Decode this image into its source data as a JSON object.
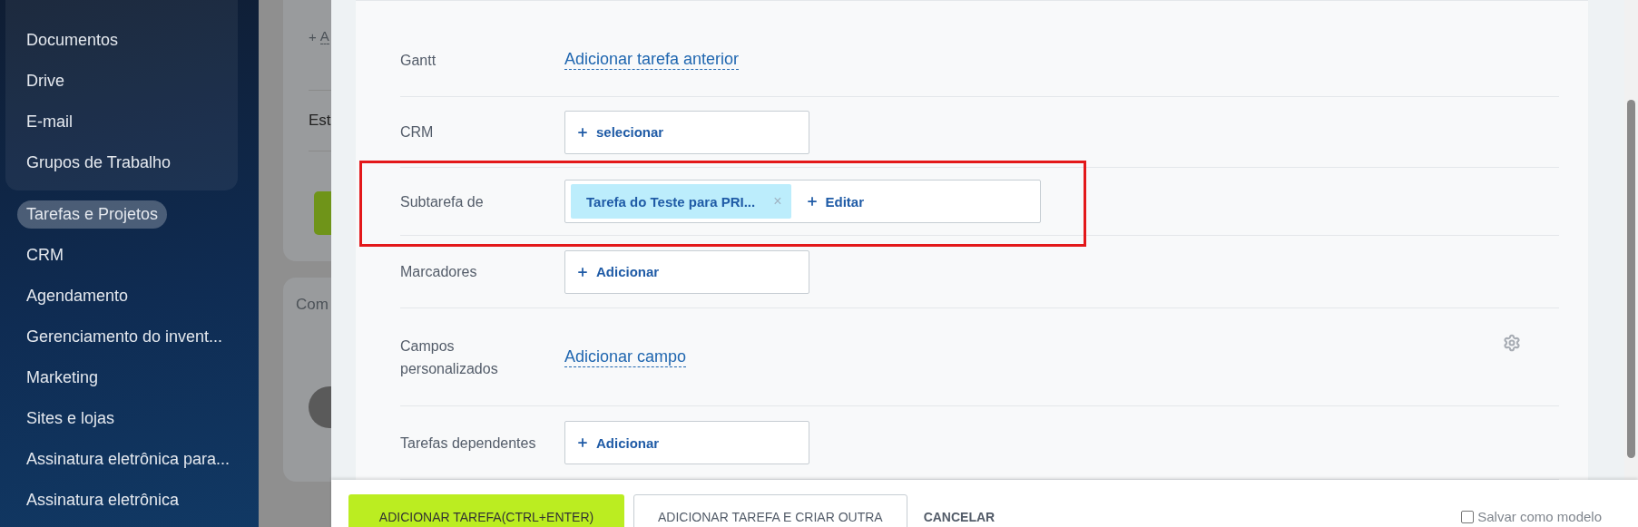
{
  "sidebar": {
    "group_items": [
      {
        "label": "Documentos",
        "selected": false
      },
      {
        "label": "Drive",
        "selected": false
      },
      {
        "label": "E-mail",
        "selected": false
      },
      {
        "label": "Grupos de Trabalho",
        "selected": false
      }
    ],
    "items": [
      {
        "label": "Tarefas e Projetos",
        "selected": true
      },
      {
        "label": "CRM",
        "selected": false
      },
      {
        "label": "Agendamento",
        "selected": false
      },
      {
        "label": "Gerenciamento do invent...",
        "selected": false
      },
      {
        "label": "Marketing",
        "selected": false
      },
      {
        "label": "Sites e lojas",
        "selected": false
      },
      {
        "label": "Assinatura eletrônica para...",
        "selected": false
      },
      {
        "label": "Assinatura eletrônica",
        "selected": false
      }
    ]
  },
  "background_page": {
    "card_link_plus": "+",
    "card_link": "A",
    "card_row": "Est",
    "comments_title": "Com"
  },
  "form": {
    "rows": [
      {
        "label": "Gantt",
        "kind": "link",
        "link": "Adicionar tarefa anterior",
        "highlighted": false,
        "gear": false
      },
      {
        "label": "CRM",
        "kind": "picker",
        "action": "selecionar",
        "highlighted": false
      },
      {
        "label": "Subtarefa de",
        "kind": "tags",
        "tags": [
          {
            "label": "Tarefa do Teste para PRI...",
            "remove": "×"
          }
        ],
        "action": "Editar",
        "highlighted": true
      },
      {
        "label": "Marcadores",
        "kind": "picker",
        "action": "Adicionar",
        "highlighted": false
      },
      {
        "label": "Campos personalizados",
        "kind": "link",
        "link": "Adicionar campo",
        "highlighted": false,
        "gear": true
      },
      {
        "label": "Tarefas dependentes",
        "kind": "picker",
        "action": "Adicionar",
        "highlighted": false
      }
    ]
  },
  "footer": {
    "buttons": [
      {
        "label": "ADICIONAR TAREFA(CTRL+ENTER)",
        "kind": "primary"
      },
      {
        "label": "ADICIONAR TAREFA E CRIAR OUTRA",
        "kind": "secondary"
      },
      {
        "label": "CANCELAR",
        "kind": "plain"
      }
    ],
    "template_checkbox": {
      "label": "Salvar como modelo",
      "checked": false
    }
  }
}
